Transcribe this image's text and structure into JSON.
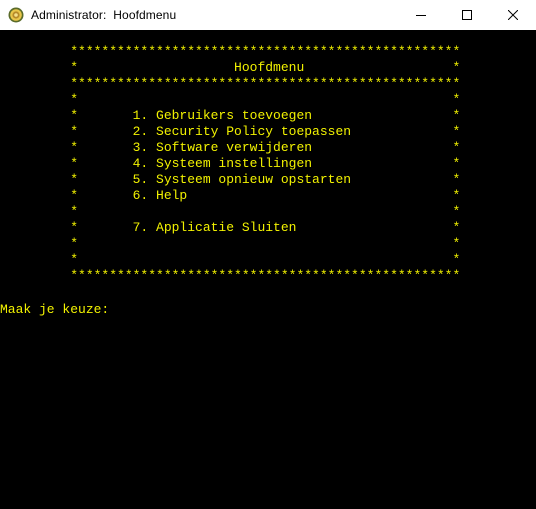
{
  "window": {
    "title": "Administrator:  Hoofdmenu"
  },
  "console": {
    "lines": [
      "         **************************************************",
      "         *                    Hoofdmenu                   *",
      "         **************************************************",
      "         *                                                *",
      "         *       1. Gebruikers toevoegen                  *",
      "         *       2. Security Policy toepassen             *",
      "         *       3. Software verwijderen                  *",
      "         *       4. Systeem instellingen                  *",
      "         *       5. Systeem opnieuw opstarten             *",
      "         *       6. Help                                  *",
      "         *                                                *",
      "         *       7. Applicatie Sluiten                    *",
      "         *                                                *",
      "         *                                                *",
      "         **************************************************",
      "",
      "Maak je keuze:"
    ],
    "text_color": "#f2f200",
    "background": "#000000"
  },
  "icons": {
    "app": "console-app-icon",
    "minimize": "minimize-icon",
    "maximize": "maximize-icon",
    "close": "close-icon"
  }
}
